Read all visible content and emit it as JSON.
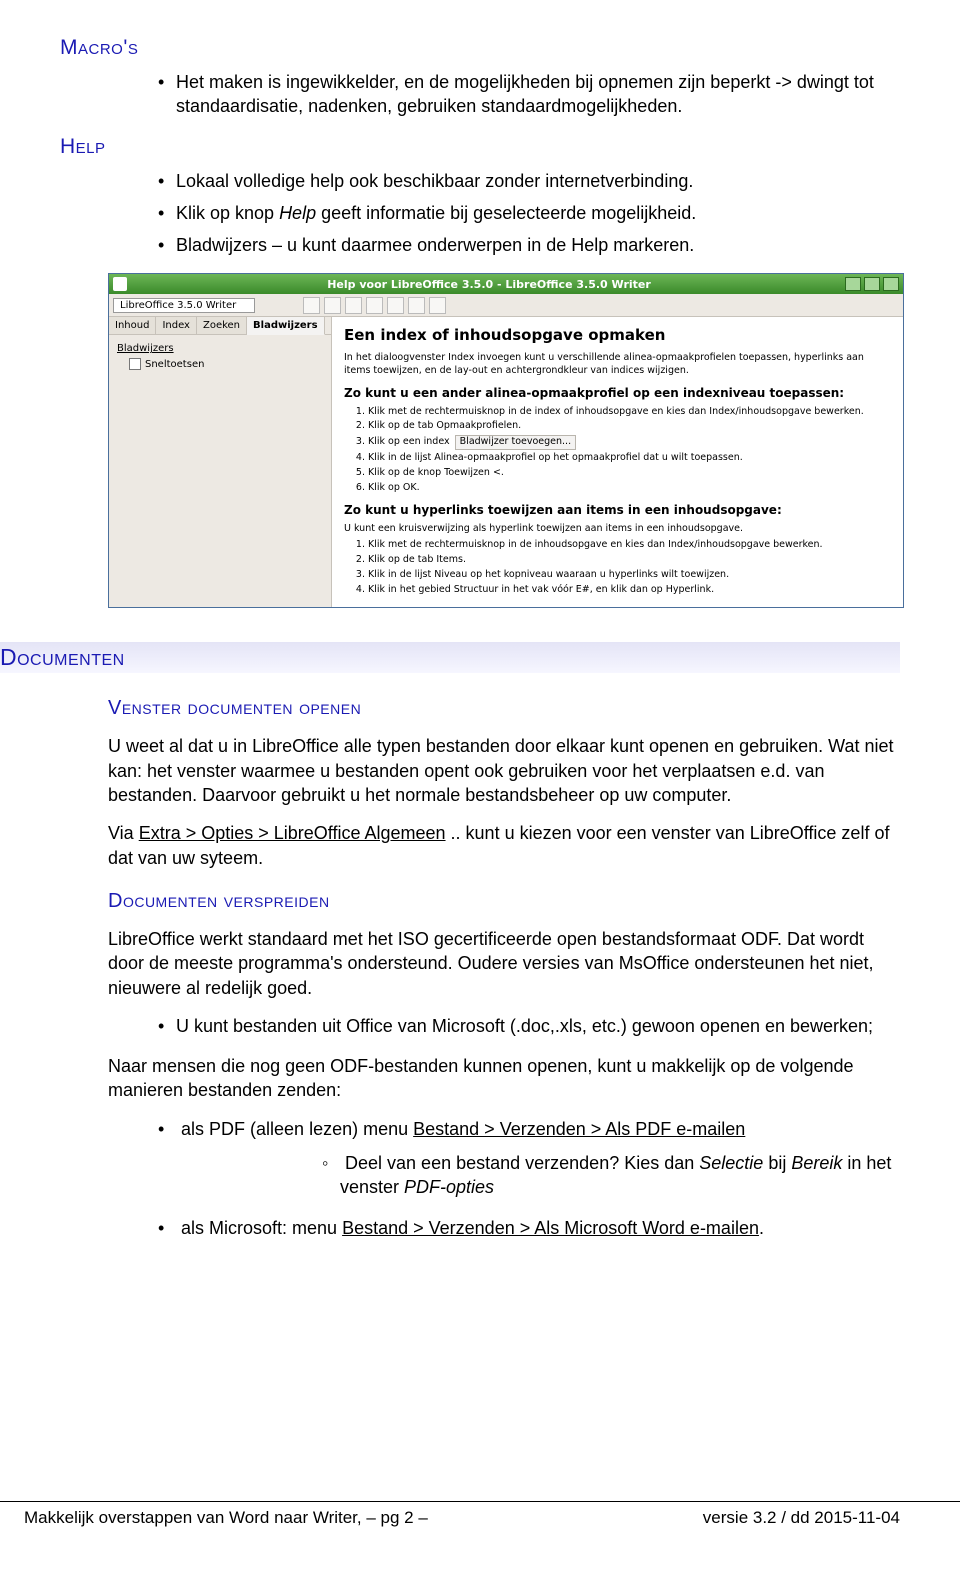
{
  "sections": {
    "macros": {
      "title": "Macro's"
    },
    "help": {
      "title": "Help"
    },
    "documenten": {
      "title": "Documenten"
    },
    "venster": {
      "title": "Venster documenten openen"
    },
    "verspreiden": {
      "title": "Documenten verspreiden"
    }
  },
  "macro_item": "Het maken is ingewikkelder, en de mogelijkheden bij opnemen zijn beperkt -> dwingt tot standaardisatie, nadenken, gebruiken standaardmogelijkheden.",
  "help_items": [
    "Lokaal volledige help ook beschikbaar zonder internetverbinding.",
    "Klik op knop Help geeft informatie bij geselecteerde mogelijkheid.",
    "Bladwijzers – u kunt daarmee onderwerpen in de Help markeren."
  ],
  "help_italic_word": "Help",
  "venster_p1": "U weet al dat u in LibreOffice alle typen bestanden door elkaar kunt openen en gebruiken. Wat niet kan: het venster waarmee u bestanden opent ook gebruiken voor het verplaatsen e.d. van bestanden. Daarvoor gebruikt u het normale bestandsbeheer op uw computer.",
  "venster_p2_pre": "Via ",
  "venster_p2_link": "Extra > Opties > LibreOffice Algemeen",
  "venster_p2_post": " .. kunt u kiezen voor een venster van LibreOffice zelf of dat van uw syteem.",
  "verspreiden_p1": "LibreOffice werkt standaard met het ISO gecertificeerde open bestandsformaat ODF. Dat wordt door de meeste programma's ondersteund. Oudere versies van MsOffice ondersteunen het niet, nieuwere al redelijk goed.",
  "verspreiden_b1": "U kunt bestanden uit Office van Microsoft (.doc,.xls, etc.) gewoon openen en bewerken;",
  "verspreiden_p2": "Naar mensen die nog geen ODF-bestanden kunnen openen, kunt u makkelijk op de volgende manieren bestanden zenden:",
  "verspreiden_b2_pre": "als PDF (alleen lezen) menu ",
  "verspreiden_b2_link": "Bestand > Verzenden > Als PDF e-mailen",
  "verspreiden_b2_sub_pre": "Deel van een bestand verzenden? Kies dan ",
  "verspreiden_b2_sub_i1": "Selectie",
  "verspreiden_b2_sub_mid": " bij ",
  "verspreiden_b2_sub_i2": "Bereik",
  "verspreiden_b2_sub_post": " in het venster ",
  "verspreiden_b2_sub_i3": "PDF-opties",
  "verspreiden_b3_pre": "als Microsoft: menu ",
  "verspreiden_b3_link": "Bestand > Verzenden > Als Microsoft Word e-mailen",
  "verspreiden_b3_post": ".",
  "footer": {
    "left": "Makkelijk overstappen van Word naar Writer,     – pg  2 –",
    "right": "versie 3.2 / dd 2015-11-04"
  },
  "ss": {
    "title": "Help voor LibreOffice 3.5.0 - LibreOffice 3.5.0 Writer",
    "selector": "LibreOffice 3.5.0 Writer",
    "tabs": [
      "Inhoud",
      "Index",
      "Zoeken",
      "Bladwijzers"
    ],
    "tree_header": "Bladwijzers",
    "tree_item": "Sneltoetsen",
    "h1": "Een index of inhoudsopgave opmaken",
    "intro": "In het dialoogvenster Index invoegen kunt u verschillende alinea-opmaakprofielen toepassen, hyperlinks aan items toewijzen, en de lay-out en achtergrondkleur van indices wijzigen.",
    "h2a": "Zo kunt u een ander alinea-opmaakprofiel op een indexniveau toepassen:",
    "ol_a": [
      "Klik met de rechtermuisknop in de index of inhoudsopgave en kies dan Index/inhoudsopgave bewerken.",
      "Klik op de tab Opmaakprofielen.",
      "Klik op een index",
      "Klik in de lijst Alinea-opmaakprofiel op het opmaakprofiel dat u wilt toepassen.",
      "Klik op de knop Toewijzen <.",
      "Klik op OK."
    ],
    "ol_a_tip": "Bladwijzer toevoegen...",
    "h2b": "Zo kunt u hyperlinks toewijzen aan items in een inhoudsopgave:",
    "intro_b": "U kunt een kruisverwijzing als hyperlink toewijzen aan items in een inhoudsopgave.",
    "ol_b": [
      "Klik met de rechtermuisknop in de inhoudsopgave en kies dan Index/inhoudsopgave bewerken.",
      "Klik op de tab Items.",
      "Klik in de lijst Niveau op het kopniveau waaraan u hyperlinks wilt toewijzen.",
      "Klik in het gebied Structuur in het vak vóór E#, en klik dan op Hyperlink."
    ]
  }
}
